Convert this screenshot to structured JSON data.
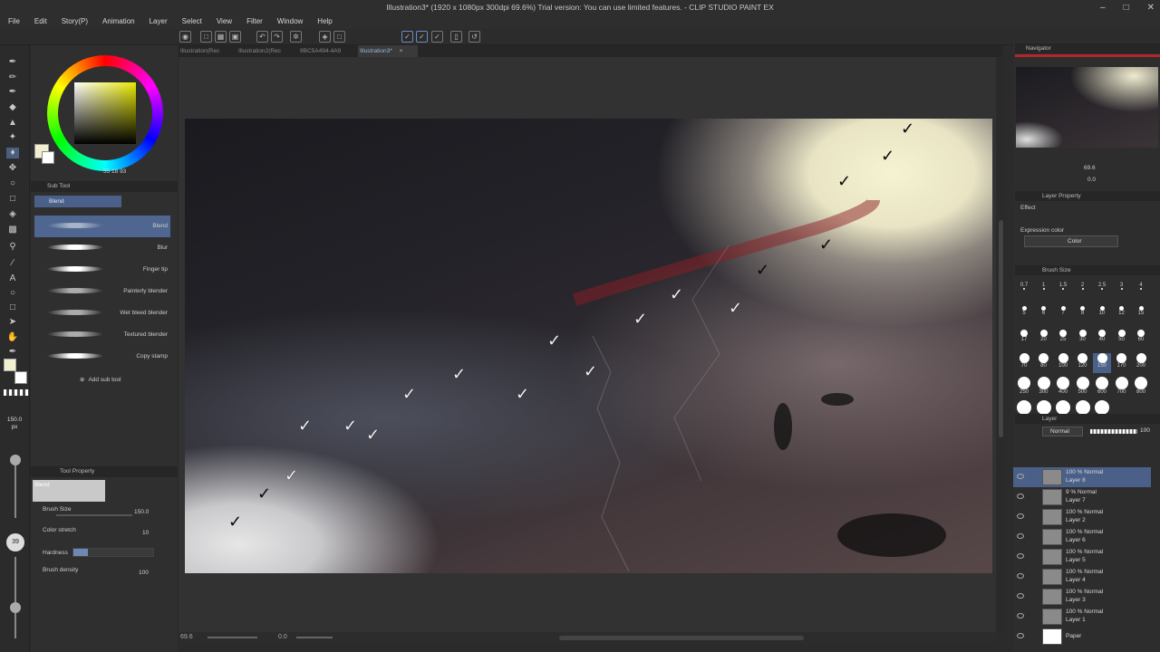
{
  "window": {
    "title": "Illustration3* (1920 x 1080px 300dpi 69.6%)  Trial version: You can use limited features. - CLIP STUDIO PAINT EX"
  },
  "menu": [
    "File",
    "Edit",
    "Story(P)",
    "Animation",
    "Layer",
    "Select",
    "View",
    "Filter",
    "Window",
    "Help"
  ],
  "tabs": [
    {
      "label": "Illustration(Rec"
    },
    {
      "label": "Illustration2(Rec"
    },
    {
      "label": "9BC5A494-4A9"
    },
    {
      "label": "Illustration3*"
    }
  ],
  "color": {
    "main": "#f2f0d0",
    "sub": "#ffffff",
    "hsv_label": "55  18  93"
  },
  "subtool": {
    "header": "Sub Tool",
    "group": "Blend",
    "items": [
      "Blend",
      "Blur",
      "Finger tip",
      "Painterly blender",
      "Wet bleed blender",
      "Textured blender",
      "Copy stamp"
    ],
    "add": "Add sub tool"
  },
  "tool_size": {
    "value": "150.0",
    "unit": "px",
    "opacity": "39"
  },
  "tool_property": {
    "header": "Tool Property",
    "name": "Blend",
    "brush_size_label": "Brush Size",
    "brush_size": "150.0",
    "color_stretch_label": "Color stretch",
    "color_stretch": "10",
    "hardness_label": "Hardness",
    "brush_density_label": "Brush density",
    "brush_density": "100"
  },
  "navigator": {
    "header": "Navigator",
    "zoom": "69.6",
    "angle": "0.0"
  },
  "layer_property": {
    "header": "Layer Property",
    "effect": "Effect",
    "expression_color_label": "Expression color",
    "expression_color": "Color"
  },
  "brush_size_panel": {
    "header": "Brush Size",
    "sizes": [
      "0.7",
      "1",
      "1.5",
      "2",
      "2.5",
      "3",
      "4",
      "5",
      "6",
      "7",
      "8",
      "10",
      "12",
      "15",
      "17",
      "20",
      "25",
      "30",
      "40",
      "50",
      "60",
      "70",
      "80",
      "100",
      "120",
      "150",
      "170",
      "200",
      "250",
      "300",
      "400",
      "500",
      "600",
      "700",
      "800",
      "1000",
      "1200",
      "1500",
      "1700",
      "2000"
    ]
  },
  "layer_panel": {
    "header": "Layer",
    "blend_mode": "Normal",
    "opacity": "100",
    "layers": [
      {
        "opacity_mode": "100 % Normal",
        "name": "Layer 8"
      },
      {
        "opacity_mode": "9 % Normal",
        "name": "Layer 7"
      },
      {
        "opacity_mode": "100 % Normal",
        "name": "Layer 2"
      },
      {
        "opacity_mode": "100 % Normal",
        "name": "Layer 6"
      },
      {
        "opacity_mode": "100 % Normal",
        "name": "Layer 5"
      },
      {
        "opacity_mode": "100 % Normal",
        "name": "Layer 4"
      },
      {
        "opacity_mode": "100 % Normal",
        "name": "Layer 3"
      },
      {
        "opacity_mode": "100 % Normal",
        "name": "Layer 1"
      },
      {
        "opacity_mode": "",
        "name": "Paper"
      }
    ]
  },
  "status": {
    "zoom": "69.6",
    "angle": "0.0"
  }
}
